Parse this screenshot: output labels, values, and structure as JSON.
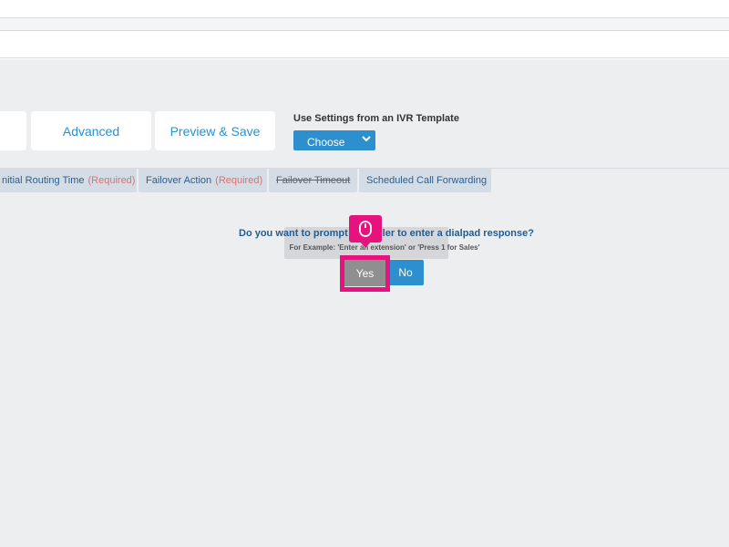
{
  "tabs": [
    {
      "label": ""
    },
    {
      "label": "Advanced"
    },
    {
      "label": "Preview & Save"
    }
  ],
  "template": {
    "label": "Use Settings from an IVR Template",
    "select_value": "Choose",
    "arrow_icon": "chevron-down-icon"
  },
  "subtabs": [
    {
      "label": "nitial Routing Time",
      "required": "(Required)"
    },
    {
      "label": "Failover Action",
      "required": "(Required)"
    },
    {
      "label": "Failover Timeout"
    },
    {
      "label": "Scheduled Call Forwarding"
    }
  ],
  "prompt": {
    "question": "Do you want to prompt the caller to enter a dialpad response?",
    "example": "For Example: 'Enter an extension' or 'Press 1 for Sales'",
    "yes_label": "Yes",
    "no_label": "No"
  },
  "annotation": {
    "cursor_icon": "mouse-click-icon",
    "color": "#e6127e"
  },
  "colors": {
    "accent": "#2d8fce",
    "required": "#e26e6e",
    "subtab_bg": "#d4dde6",
    "yes_bg": "#8f8f8f"
  }
}
